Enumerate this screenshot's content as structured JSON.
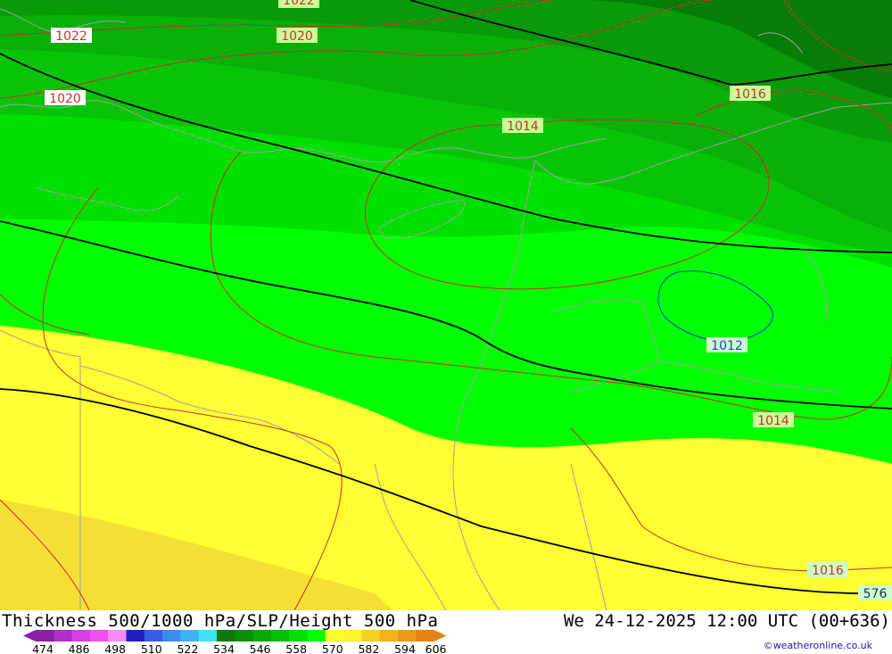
{
  "title": "Thickness 500/1000 hPa/SLP/Height 500 hPa",
  "valid_time": "We 24-12-2025 12:00 UTC (00+636)",
  "credit": "©weatheronline.co.uk",
  "legend": {
    "colors": [
      "#8a1fa8",
      "#b22cc8",
      "#d53ee0",
      "#f050f0",
      "#f58cf5",
      "#2020c0",
      "#3a5ae8",
      "#3c8cf0",
      "#3cb4f5",
      "#40e0f5",
      "#0a7a0a",
      "#089008",
      "#08a808",
      "#04c004",
      "#00e000",
      "#00ff00",
      "#ffff30",
      "#fff030",
      "#f5d225",
      "#f0b41e",
      "#ec9a18",
      "#e8820e"
    ],
    "ticks": [
      "474",
      "486",
      "498",
      "510",
      "522",
      "534",
      "546",
      "558",
      "570",
      "582",
      "594",
      "606"
    ]
  },
  "isobar_labels": [
    {
      "text": "1022",
      "color": "#c83030"
    },
    {
      "text": "1020",
      "color": "#c83030"
    },
    {
      "text": "1022",
      "color": "#c83030"
    },
    {
      "text": "1020",
      "color": "#c83030"
    },
    {
      "text": "1014",
      "color": "#c83030"
    },
    {
      "text": "1016",
      "color": "#c83030"
    },
    {
      "text": "1012",
      "color": "#2040c0"
    },
    {
      "text": "1014",
      "color": "#c83030"
    },
    {
      "text": "1016",
      "color": "#c83030"
    }
  ],
  "height_labels": [
    {
      "text": "576",
      "color": "#203060"
    }
  ]
}
